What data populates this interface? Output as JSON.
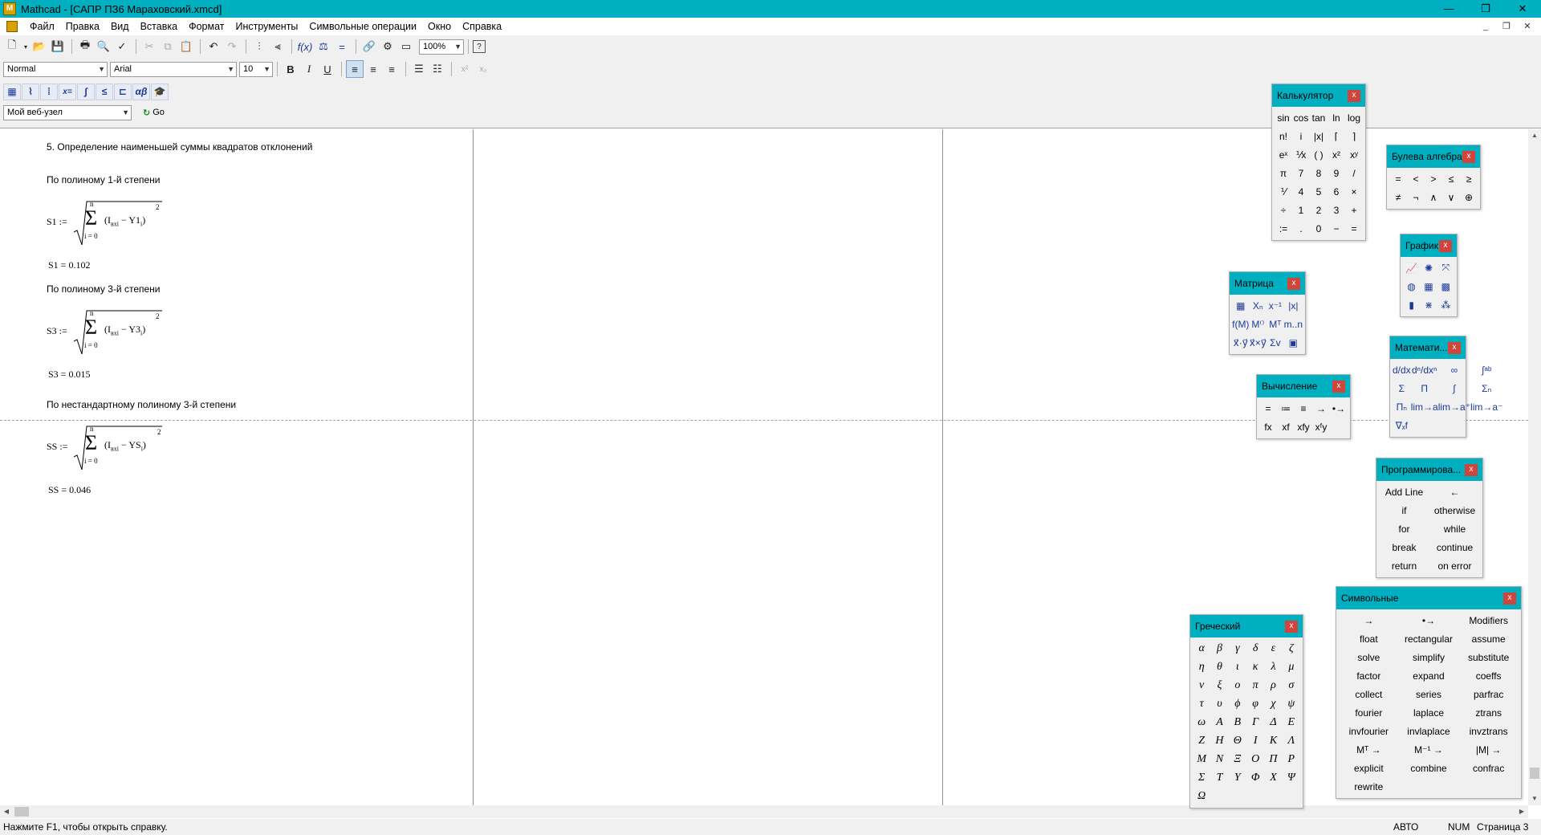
{
  "titlebar": {
    "app_icon": "M",
    "title": "Mathcad - [САПР ПЗ6 Мараховский.xmcd]",
    "minimize": "—",
    "maximize": "❐",
    "close": "✕"
  },
  "menubar": {
    "items": [
      "Файл",
      "Правка",
      "Вид",
      "Вставка",
      "Формат",
      "Инструменты",
      "Символьные операции",
      "Окно",
      "Справка"
    ],
    "mdi_min": "_",
    "mdi_restore": "❐",
    "mdi_close": "✕"
  },
  "toolbar": {
    "zoom": "100%",
    "style": "Normal",
    "font": "Arial",
    "size": "10",
    "bold": "B",
    "italic": "I",
    "underline": "U",
    "web_node": "Мой веб-узел",
    "go": "Go"
  },
  "worksheet": {
    "heading": "5. Определение наименьшей суммы квадратов отклонений",
    "label1": "По полиному 1-й степени",
    "label3": "По полиному 3-й степени",
    "label_ns": "По нестандартному полиному 3-й степени",
    "formulas": [
      {
        "lhs": "S1 :=",
        "n": "n",
        "lower": "i = 0",
        "body_pre": "(I",
        "body_sub1": "вх",
        "body_sub2": "i",
        "body_mid": " − Y1",
        "body_sub3": "i",
        "body_post": ")",
        "exp": "2",
        "result": "S1 = 0.102"
      },
      {
        "lhs": "S3 :=",
        "n": "n",
        "lower": "i = 0",
        "body_pre": "(I",
        "body_sub1": "вх",
        "body_sub2": "i",
        "body_mid": " − Y3",
        "body_sub3": "i",
        "body_post": ")",
        "exp": "2",
        "result": "S3 = 0.015"
      },
      {
        "lhs": "SS :=",
        "n": "n",
        "lower": "i = 0",
        "body_pre": "(I",
        "body_sub1": "вх",
        "body_sub2": "i",
        "body_mid": " − YS",
        "body_sub3": "i",
        "body_post": ")",
        "exp": "2",
        "result": "SS = 0.046"
      }
    ]
  },
  "statusbar": {
    "help": "Нажмите F1, чтобы открыть справку.",
    "mode": "АВТО",
    "num": "NUM",
    "page": "Страница 3"
  },
  "palettes": {
    "calculator": {
      "title": "Калькулятор",
      "cells": [
        "sin",
        "cos",
        "tan",
        "ln",
        "log",
        "n!",
        "i",
        "|x|",
        "⌈",
        "⌉",
        "eˣ",
        "⅟x",
        "( )",
        "x²",
        "xʸ",
        "π",
        "7",
        "8",
        "9",
        "/",
        "⅟",
        "4",
        "5",
        "6",
        "×",
        "÷",
        "1",
        "2",
        "3",
        "+",
        ":=",
        ".",
        "0",
        "−",
        "="
      ]
    },
    "boolean": {
      "title": "Булева алгебра",
      "cells": [
        "=",
        "<",
        ">",
        "≤",
        "≥",
        "≠",
        "¬",
        "∧",
        "∨",
        "⊕"
      ]
    },
    "graph": {
      "title": "График",
      "cells": [
        "📈",
        "✺",
        "⤧",
        "◍",
        "▦",
        "▩",
        "▮",
        "⋇",
        "⁂"
      ]
    },
    "matrix": {
      "title": "Матрица",
      "cells": [
        "▦",
        "Xₙ",
        "x⁻¹",
        "|x|",
        "f(M)",
        "M⁽⁾",
        "Mᵀ",
        "m..n",
        "x⃗·y⃗",
        "x⃗×y⃗",
        "Σv",
        "▣"
      ]
    },
    "evaluation": {
      "title": "Вычисление",
      "cells": [
        "=",
        "≔",
        "≡",
        "→",
        "•→",
        "fx",
        "xf",
        "xfy",
        "xᶠy"
      ]
    },
    "calculus": {
      "title": "Математи...",
      "cells": [
        "d/dx",
        "dⁿ/dxⁿ",
        "∞",
        "∫ᵃᵇ",
        "Σ",
        "Π",
        "∫",
        "Σₙ",
        "Πₙ",
        "lim→a",
        "lim→a⁺",
        "lim→a⁻",
        "∇ₓf"
      ]
    },
    "programming": {
      "title": "Программирова...",
      "cells": [
        "Add Line",
        "←",
        "if",
        "otherwise",
        "for",
        "while",
        "break",
        "continue",
        "return",
        "on error"
      ]
    },
    "symbolic": {
      "title": "Символьные",
      "cells": [
        "→",
        "•→",
        "Modifiers",
        "float",
        "rectangular",
        "assume",
        "solve",
        "simplify",
        "substitute",
        "factor",
        "expand",
        "coeffs",
        "collect",
        "series",
        "parfrac",
        "fourier",
        "laplace",
        "ztrans",
        "invfourier",
        "invlaplace",
        "invztrans",
        "Mᵀ →",
        "M⁻¹ →",
        "|M| →",
        "explicit",
        "combine",
        "confrac",
        "rewrite"
      ]
    },
    "greek": {
      "title": "Греческий",
      "cells": [
        "α",
        "β",
        "γ",
        "δ",
        "ε",
        "ζ",
        "η",
        "θ",
        "ι",
        "κ",
        "λ",
        "μ",
        "ν",
        "ξ",
        "ο",
        "π",
        "ρ",
        "σ",
        "τ",
        "υ",
        "ϕ",
        "φ",
        "χ",
        "ψ",
        "ω",
        "Α",
        "Β",
        "Γ",
        "Δ",
        "Ε",
        "Ζ",
        "Η",
        "Θ",
        "Ι",
        "Κ",
        "Λ",
        "Μ",
        "Ν",
        "Ξ",
        "Ο",
        "Π",
        "Ρ",
        "Σ",
        "Τ",
        "Υ",
        "Φ",
        "Χ",
        "Ψ",
        "Ω"
      ]
    },
    "close_label": "x"
  }
}
